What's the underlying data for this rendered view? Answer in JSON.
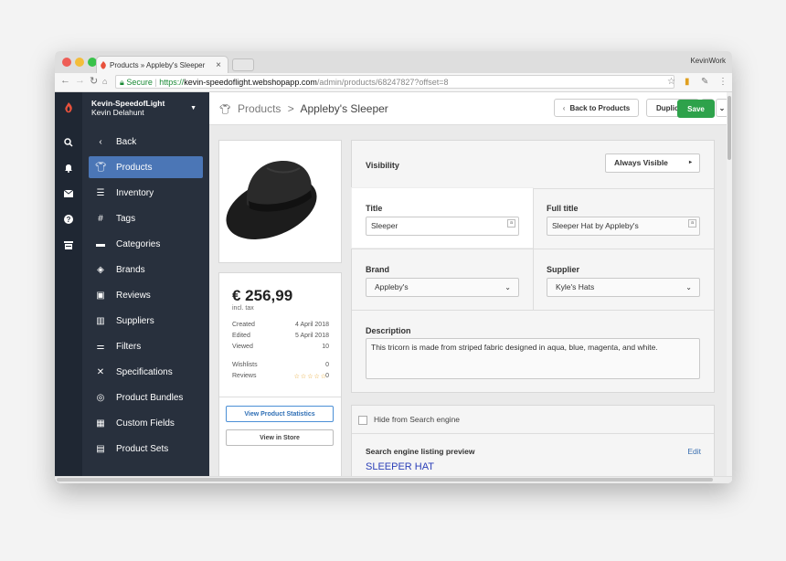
{
  "browser": {
    "tab_title": "Products » Appleby's Sleeper",
    "profile": "KevinWork",
    "secure_label": "Secure",
    "url_scheme": "https://",
    "url_host": "kevin-speedoflight.webshopapp.com",
    "url_path": "/admin/products/68247827?offset=8"
  },
  "sidebar": {
    "shop_name": "Kevin-SpeedofLight",
    "user_name": "Kevin Delahunt",
    "back_label": "Back",
    "items": [
      {
        "label": "Products",
        "icon": "shirt-icon",
        "active": true
      },
      {
        "label": "Inventory",
        "icon": "inventory-icon"
      },
      {
        "label": "Tags",
        "icon": "hash-icon"
      },
      {
        "label": "Categories",
        "icon": "folder-icon"
      },
      {
        "label": "Brands",
        "icon": "tag-icon"
      },
      {
        "label": "Reviews",
        "icon": "review-icon"
      },
      {
        "label": "Suppliers",
        "icon": "suppliers-icon"
      },
      {
        "label": "Filters",
        "icon": "filter-icon"
      },
      {
        "label": "Specifications",
        "icon": "tools-icon"
      },
      {
        "label": "Product Bundles",
        "icon": "layers-icon"
      },
      {
        "label": "Custom Fields",
        "icon": "grid-icon"
      },
      {
        "label": "Product Sets",
        "icon": "box-icon"
      }
    ]
  },
  "header": {
    "breadcrumb_parent": "Products",
    "breadcrumb_separator": ">",
    "breadcrumb_current": "Appleby's Sleeper",
    "back_button": "Back to Products",
    "duplicate_button": "Duplicate",
    "save_button": "Save"
  },
  "product": {
    "price": "€ 256,99",
    "tax_note": "incl. tax",
    "stats": [
      {
        "label": "Created",
        "value": "4 April 2018"
      },
      {
        "label": "Edited",
        "value": "5 April 2018"
      },
      {
        "label": "Viewed",
        "value": "10"
      }
    ],
    "wishlists_label": "Wishlists",
    "wishlists_value": "0",
    "reviews_label": "Reviews",
    "reviews_stars": "☆☆☆☆☆",
    "reviews_value": "0",
    "view_stats_button": "View Product Statistics",
    "view_store_button": "View in Store"
  },
  "form": {
    "visibility_label": "Visibility",
    "visibility_value": "Always Visible",
    "title_label": "Title",
    "title_value": "Sleeper",
    "full_title_label": "Full title",
    "full_title_value": "Sleeper Hat by Appleby's",
    "brand_label": "Brand",
    "brand_value": "Appleby's",
    "supplier_label": "Supplier",
    "supplier_value": "Kyle's Hats",
    "description_label": "Description",
    "description_value": "This tricorn is made from striped fabric designed in aqua, blue, magenta, and white.",
    "hide_search_label": "Hide from Search engine",
    "seo_heading": "Search engine listing preview",
    "seo_edit": "Edit",
    "seo_title": "SLEEPER HAT"
  },
  "colors": {
    "accent": "#4b76b6",
    "save": "#2ea24b",
    "sidebar": "#28303d"
  }
}
